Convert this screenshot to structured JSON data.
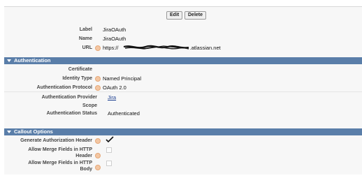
{
  "toolbar": {
    "edit_label": "Edit",
    "delete_label": "Delete"
  },
  "details": [
    {
      "label": "Label",
      "value": "JiraOAuth"
    },
    {
      "label": "Name",
      "value": "JiraOAuth"
    },
    {
      "label": "URL",
      "value_prefix": "https://",
      "value_suffix": ".atlassian.net"
    }
  ],
  "authentication": {
    "title": "Authentication",
    "fields": [
      {
        "label": "Certificate",
        "value": ""
      },
      {
        "label": "Identity Type",
        "value": "Named Principal"
      },
      {
        "label": "Authentication Protocol",
        "value": "OAuth 2.0"
      },
      {
        "label": "Authentication Provider",
        "value": "Jira"
      },
      {
        "label": "Scope",
        "value": ""
      },
      {
        "label": "Authentication Status",
        "value": "Authenticated"
      }
    ]
  },
  "callout": {
    "title": "Callout Options",
    "fields": [
      {
        "label": "Generate Authorization Header",
        "checked": true
      },
      {
        "label_line1": "Allow Merge Fields in HTTP",
        "label_line2": "Header",
        "checked": false
      },
      {
        "label_line1": "Allow Merge Fields in HTTP",
        "label_line2": "Body",
        "checked": false
      }
    ]
  },
  "colors": {
    "section_header": "#5a7ea9",
    "help_icon": "#f3c7a4",
    "link": "#1a3d8f"
  }
}
